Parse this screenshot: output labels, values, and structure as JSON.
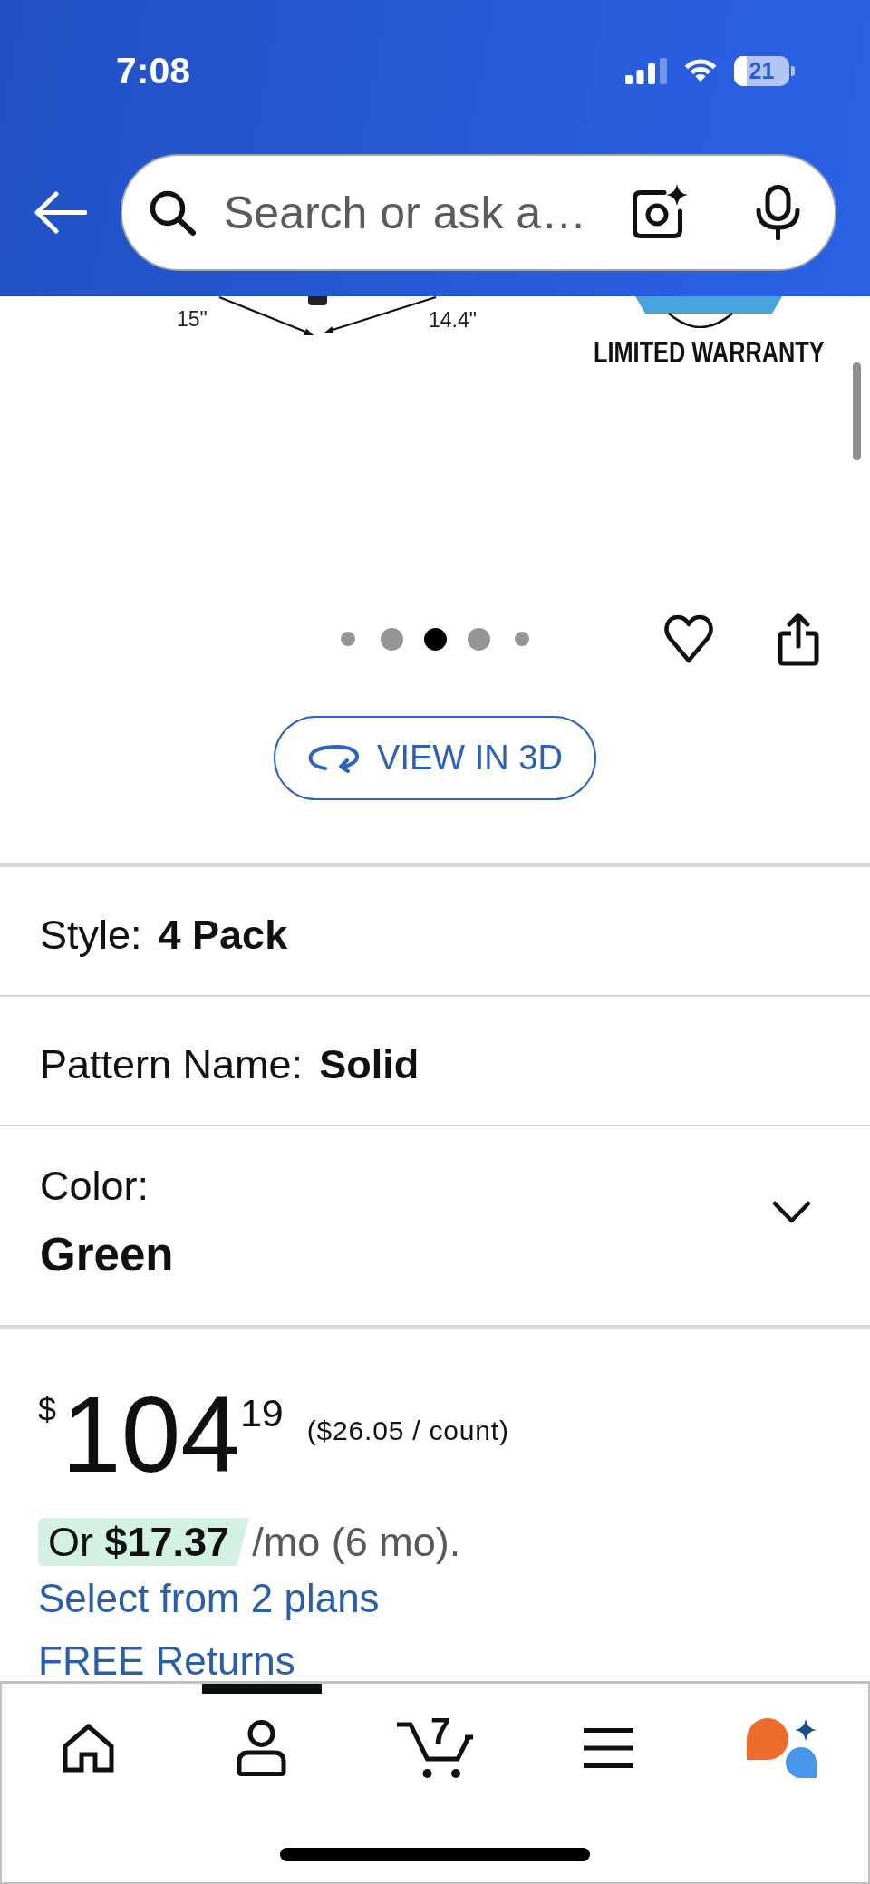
{
  "status_bar": {
    "time": "7:08",
    "battery": "21"
  },
  "search": {
    "placeholder": "Search or ask a…"
  },
  "product_image": {
    "dimension_labels": [
      "15\"",
      "14.4\""
    ],
    "badge_text": "LIMITED WARRANTY"
  },
  "image_dots": [
    {
      "selected": false
    },
    {
      "selected": false
    },
    {
      "selected": true
    },
    {
      "selected": false
    },
    {
      "selected": false
    }
  ],
  "view_3d_button": {
    "label": "VIEW IN 3D"
  },
  "options": [
    {
      "kind": "inline",
      "label": "Style:",
      "value": "4 Pack"
    },
    {
      "kind": "inline",
      "label": "Pattern Name:",
      "value": "Solid"
    },
    {
      "kind": "dropdown",
      "label": "Color:",
      "value": "Green"
    }
  ],
  "price": {
    "currency": "$",
    "whole": "104",
    "fraction": "19",
    "unit_price": "($26.05 / count)"
  },
  "installment": {
    "offer": "Or **$17.37**",
    "term": "/mo (6 mo)."
  },
  "plans_link": "Select from 2 plans",
  "returns_link": "FREE Returns",
  "bottom_nav": [
    {
      "kind": "home",
      "selected": false
    },
    {
      "kind": "account",
      "selected": true
    },
    {
      "kind": "cart",
      "selected": false,
      "count": "7"
    },
    {
      "kind": "menu",
      "selected": false
    },
    {
      "kind": "assistant",
      "selected": false
    }
  ]
}
